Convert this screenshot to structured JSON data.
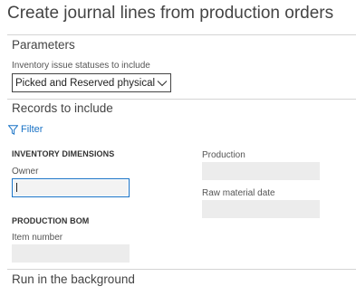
{
  "dialog": {
    "title": "Create journal lines from production orders"
  },
  "parameters": {
    "heading": "Parameters",
    "inventory_issue_label": "Inventory issue statuses to include",
    "inventory_issue_value": "Picked and Reserved physical"
  },
  "records": {
    "heading": "Records to include",
    "filter_label": "Filter"
  },
  "inventory_dimensions": {
    "heading": "INVENTORY DIMENSIONS",
    "owner_label": "Owner",
    "owner_value": ""
  },
  "production": {
    "production_label": "Production",
    "production_value": "",
    "raw_material_date_label": "Raw material date",
    "raw_material_date_value": ""
  },
  "production_bom": {
    "heading": "PRODUCTION BOM",
    "item_number_label": "Item number",
    "item_number_value": ""
  },
  "run_in_background": {
    "heading": "Run in the background"
  },
  "colors": {
    "accent": "#1a73c6",
    "input_fill": "#ececec",
    "divider": "#d4d4d4"
  }
}
